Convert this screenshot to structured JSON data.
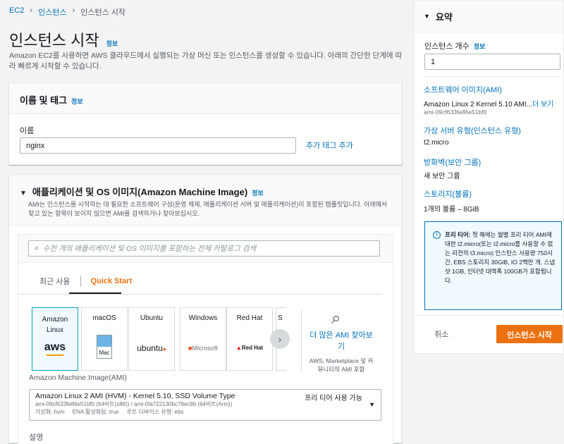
{
  "breadcrumb": [
    "EC2",
    "인스턴스",
    "인스턴스 시작"
  ],
  "page": {
    "title": "인스턴스 시작",
    "info": "정보",
    "description": "Amazon EC2를 사용하면 AWS 클라우드에서 실행되는 가상 머신 또는 인스턴스를 생성할 수 있습니다. 아래의 간단한 단계에 따라 빠르게 시작할 수 있습니다."
  },
  "name_tags": {
    "title": "이름 및 태그",
    "info": "정보",
    "name_label": "이름",
    "name_value": "nginx",
    "add_tag": "추가 태그 추가"
  },
  "ami": {
    "title": "애플리케이션 및 OS 이미지(Amazon Machine Image)",
    "info": "정보",
    "description": "AMI는 인스턴스를 시작하는 데 필요한 소프트웨어 구성(운영 체제, 애플리케이션 서버 및 애플리케이션)이 포함된 템플릿입니다. 아래에서 찾고 있는 항목이 보이지 않으면 AMI를 검색하거나 찾아보십시오.",
    "search_placeholder": "수천 개의 애플리케이션 및 OS 이미지를 포함하는 전체 카탈로그 검색",
    "tabs": [
      "최근 사용",
      "Quick Start"
    ],
    "tiles": [
      {
        "name": "Amazon Linux",
        "logo": "aws"
      },
      {
        "name": "macOS",
        "logo": "Mac"
      },
      {
        "name": "Ubuntu",
        "logo": "ubuntu"
      },
      {
        "name": "Windows",
        "logo": "Microsoft"
      },
      {
        "name": "Red Hat",
        "logo": "Red Hat"
      },
      {
        "name": "S",
        "logo": ""
      }
    ],
    "browse_more": "더 많은 AMI 찾아보기",
    "browse_sub": "AWS, Marketplace 및 커뮤니티의 AMI 포함",
    "select_label": "Amazon Machine Image(AMI)",
    "selected": {
      "name": "Amazon Linux 2 AMI (HVM) - Kernel 5.10, SSD Volume Type",
      "ids": "ami-09cf633fe86e51bf0 (64비트(x86)) / ami-0fa722130bc79ec9b (64비트(Arm))",
      "meta": "가상화: hvm     ENA 활성화됨: true     루트 디바이스 유형: ebs",
      "badge": "프리 티어 사용 가능"
    },
    "desc_label": "설명"
  },
  "summary": {
    "title": "요약",
    "count_label": "인스턴스 개수",
    "info": "정보",
    "count": "1",
    "ami_label": "소프트웨어 이미지(AMI)",
    "ami_value": "Amazon Linux 2 Kernel 5.10 AMI...",
    "more": "더 보기",
    "ami_id": "ami-09cf633fe86e51bf0",
    "type_label": "가상 서버 유형(인스턴스 유형)",
    "type_value": "t2.micro",
    "fw_label": "방화벽(보안 그룹)",
    "fw_value": "새 보안 그룹",
    "storage_label": "스토리지(볼륨)",
    "storage_value": "1개의 볼륨 – 8GiB",
    "free_tier_title": "프리 티어:",
    "free_tier_text": "첫 해에는 월별 프리 티어 AMI에 대한 t2.micro(또는 t2.micro를 사용할 수 없는 리전의 t3.micro) 인스턴스 사용량 750시간, EBS 스토리지 30GiB, IO 2백만 개, 스냅샷 1GB, 인터넷 대역폭 100GB가 포함됩니다.",
    "cancel": "취소",
    "launch": "인스턴스 시작"
  }
}
